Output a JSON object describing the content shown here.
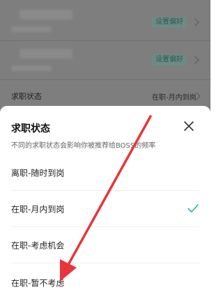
{
  "background": {
    "preference_tag_1": "设置偏好",
    "preference_tag_2": "设置偏好",
    "status_row_label": "求职状态",
    "status_row_value": "在职-月内到岗"
  },
  "sheet": {
    "title": "求职状态",
    "subtitle": "不同的求职状态会影响你被推荐给BOSS的频率",
    "close_icon": "close-icon",
    "options": [
      {
        "label": "离职-随时到岗",
        "selected": false
      },
      {
        "label": "在职-月内到岗",
        "selected": true
      },
      {
        "label": "在职-考虑机会",
        "selected": false
      },
      {
        "label": "在职-暂不考虑",
        "selected": false
      }
    ]
  },
  "colors": {
    "accent": "#2bb3a0",
    "annotation_arrow": "#e8343a",
    "overlay": "#7e7e7e"
  }
}
